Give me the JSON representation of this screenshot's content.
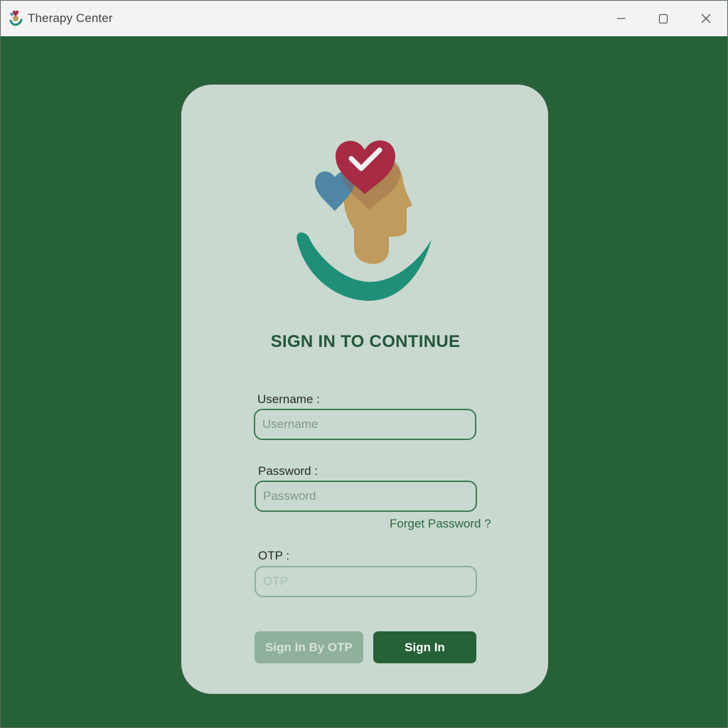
{
  "window": {
    "title": "Therapy Center"
  },
  "colors": {
    "background": "#266138",
    "card": "#c9d9cf",
    "accent": "#266138",
    "heading": "#24563a",
    "heart_red": "#a72b45",
    "heart_blue": "#4f86a6",
    "head": "#bf9b5e",
    "hand": "#1f8f78"
  },
  "icons": {
    "app": "therapy-logo-icon",
    "minimize": "minimize-icon",
    "maximize": "maximize-icon",
    "close": "close-icon"
  },
  "login": {
    "heading": "SIGN IN TO CONTINUE",
    "username_label": "Username :",
    "username_placeholder": "Username",
    "password_label": "Password :",
    "password_placeholder": "Password",
    "forget_password": "Forget Password ?",
    "otp_label": "OTP :",
    "otp_placeholder": "OTP",
    "otp_button": "Sign In By OTP",
    "signin_button": "Sign In"
  }
}
